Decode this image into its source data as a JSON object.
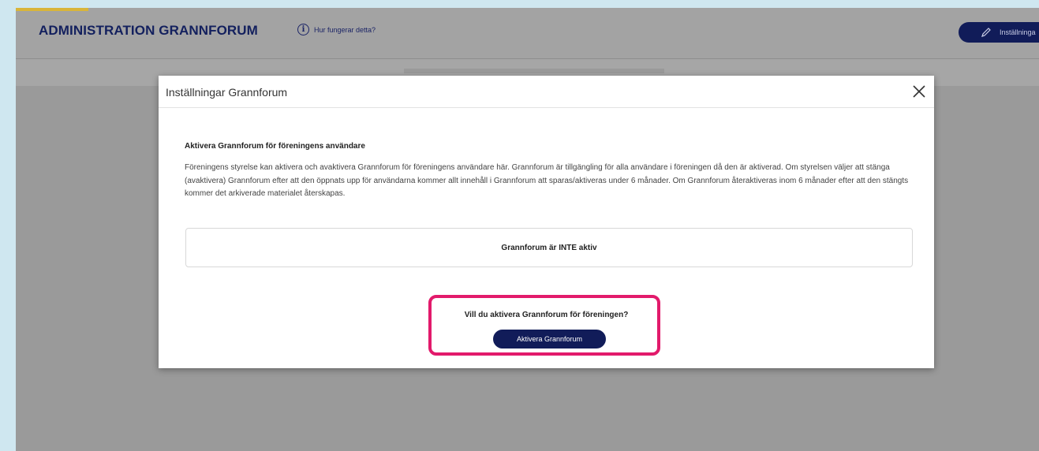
{
  "header": {
    "title": "ADMINISTRATION GRANNFORUM",
    "help_label": "Hur fungerar detta?",
    "settings_label": "Inställninga"
  },
  "modal": {
    "title": "Inställningar Grannforum",
    "section_title": "Aktivera Grannforum för föreningens användare",
    "description": "Föreningens styrelse kan aktivera och avaktivera Grannforum för föreningens användare här. Grannforum är tillgängling för alla användare i föreningen då den är aktiverad. Om styrelsen väljer att stänga (avaktivera) Grannforum efter att den öppnats upp för användarna kommer allt innehåll i Grannforum att sparas/aktiveras under 6 månader. Om Grannforum återaktiveras inom 6 månader efter att den stängts kommer det arkiverade materialet återskapas.",
    "status": "Grannforum är INTE aktiv",
    "prompt": "Vill du aktivera Grannforum för föreningen?",
    "activate_label": "Aktivera Grannforum"
  },
  "colors": {
    "brand_navy": "#111c59",
    "highlight": "#e21a6b",
    "accent_gold": "#d9b53a",
    "outer_background": "#cfe7f0"
  },
  "icons": [
    "info-icon",
    "pencil-icon",
    "close-icon"
  ]
}
